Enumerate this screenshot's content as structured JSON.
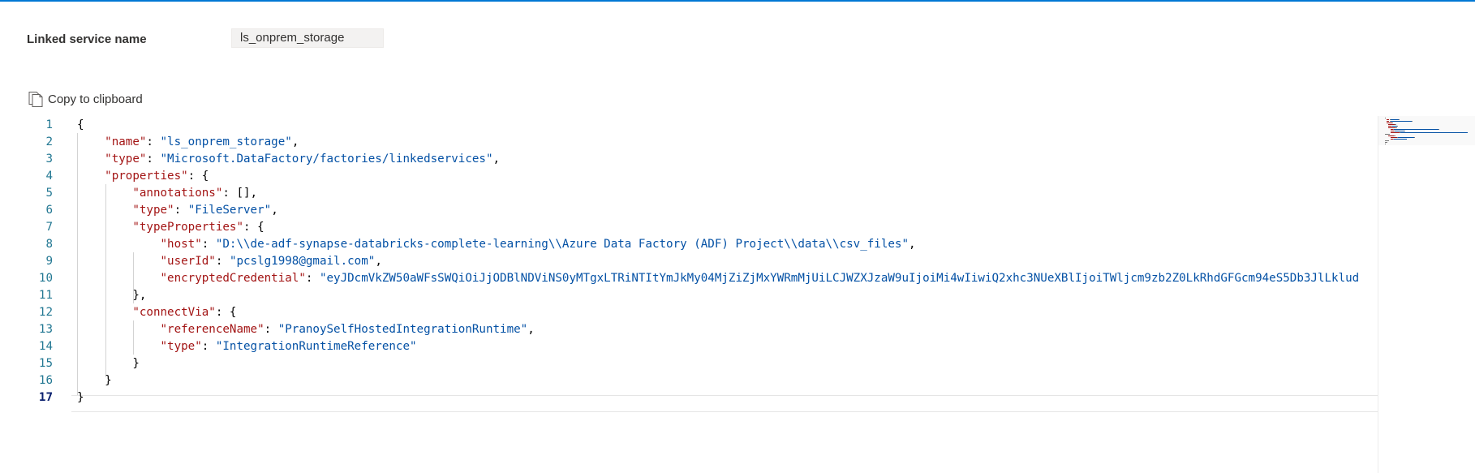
{
  "linked_service": {
    "label": "Linked service name",
    "value": "ls_onprem_storage"
  },
  "copy": {
    "label": "Copy to clipboard",
    "icon": "copy-icon"
  },
  "editor": {
    "active_line": 17,
    "lines": [
      {
        "num": "1",
        "tokens": [
          {
            "t": "punc",
            "v": "{"
          }
        ]
      },
      {
        "num": "2",
        "tokens": [
          {
            "t": "punc",
            "v": "    "
          },
          {
            "t": "key",
            "v": "\"name\""
          },
          {
            "t": "punc",
            "v": ": "
          },
          {
            "t": "str",
            "v": "\"ls_onprem_storage\""
          },
          {
            "t": "punc",
            "v": ","
          }
        ]
      },
      {
        "num": "3",
        "tokens": [
          {
            "t": "punc",
            "v": "    "
          },
          {
            "t": "key",
            "v": "\"type\""
          },
          {
            "t": "punc",
            "v": ": "
          },
          {
            "t": "str",
            "v": "\"Microsoft.DataFactory/factories/linkedservices\""
          },
          {
            "t": "punc",
            "v": ","
          }
        ]
      },
      {
        "num": "4",
        "tokens": [
          {
            "t": "punc",
            "v": "    "
          },
          {
            "t": "key",
            "v": "\"properties\""
          },
          {
            "t": "punc",
            "v": ": {"
          }
        ]
      },
      {
        "num": "5",
        "tokens": [
          {
            "t": "punc",
            "v": "        "
          },
          {
            "t": "key",
            "v": "\"annotations\""
          },
          {
            "t": "punc",
            "v": ": [],"
          }
        ]
      },
      {
        "num": "6",
        "tokens": [
          {
            "t": "punc",
            "v": "        "
          },
          {
            "t": "key",
            "v": "\"type\""
          },
          {
            "t": "punc",
            "v": ": "
          },
          {
            "t": "str",
            "v": "\"FileServer\""
          },
          {
            "t": "punc",
            "v": ","
          }
        ]
      },
      {
        "num": "7",
        "tokens": [
          {
            "t": "punc",
            "v": "        "
          },
          {
            "t": "key",
            "v": "\"typeProperties\""
          },
          {
            "t": "punc",
            "v": ": {"
          }
        ]
      },
      {
        "num": "8",
        "tokens": [
          {
            "t": "punc",
            "v": "            "
          },
          {
            "t": "key",
            "v": "\"host\""
          },
          {
            "t": "punc",
            "v": ": "
          },
          {
            "t": "str",
            "v": "\"D:\\\\de-adf-synapse-databricks-complete-learning\\\\Azure Data Factory (ADF) Project\\\\data\\\\csv_files\""
          },
          {
            "t": "punc",
            "v": ","
          }
        ]
      },
      {
        "num": "9",
        "tokens": [
          {
            "t": "punc",
            "v": "            "
          },
          {
            "t": "key",
            "v": "\"userId\""
          },
          {
            "t": "punc",
            "v": ": "
          },
          {
            "t": "str",
            "v": "\"pcslg1998@gmail.com\""
          },
          {
            "t": "punc",
            "v": ","
          }
        ]
      },
      {
        "num": "10",
        "tokens": [
          {
            "t": "punc",
            "v": "            "
          },
          {
            "t": "key",
            "v": "\"encryptedCredential\""
          },
          {
            "t": "punc",
            "v": ": "
          },
          {
            "t": "str",
            "v": "\"eyJDcmVkZW50aWFsSWQiOiJjODBlNDViNS0yMTgxLTRiNTItYmJkMy04MjZiZjMxYWRmMjUiLCJWZXJzaW9uIjoiMi4wIiwiQ2xhc3NUeXBlIjoiTWljcm9zb2Z0LkRhdGFGcm94eS5Db3JlLklud"
          }
        ]
      },
      {
        "num": "11",
        "tokens": [
          {
            "t": "punc",
            "v": "        },"
          }
        ]
      },
      {
        "num": "12",
        "tokens": [
          {
            "t": "punc",
            "v": "        "
          },
          {
            "t": "key",
            "v": "\"connectVia\""
          },
          {
            "t": "punc",
            "v": ": {"
          }
        ]
      },
      {
        "num": "13",
        "tokens": [
          {
            "t": "punc",
            "v": "            "
          },
          {
            "t": "key",
            "v": "\"referenceName\""
          },
          {
            "t": "punc",
            "v": ": "
          },
          {
            "t": "str",
            "v": "\"PranoySelfHostedIntegrationRuntime\""
          },
          {
            "t": "punc",
            "v": ","
          }
        ]
      },
      {
        "num": "14",
        "tokens": [
          {
            "t": "punc",
            "v": "            "
          },
          {
            "t": "key",
            "v": "\"type\""
          },
          {
            "t": "punc",
            "v": ": "
          },
          {
            "t": "str",
            "v": "\"IntegrationRuntimeReference\""
          }
        ]
      },
      {
        "num": "15",
        "tokens": [
          {
            "t": "punc",
            "v": "        }"
          }
        ]
      },
      {
        "num": "16",
        "tokens": [
          {
            "t": "punc",
            "v": "    }"
          }
        ]
      },
      {
        "num": "17",
        "tokens": [
          {
            "t": "punc",
            "v": "}"
          }
        ]
      }
    ]
  },
  "colors": {
    "accent": "#0078d4",
    "json_key": "#a31515",
    "json_string": "#0451a5",
    "line_number": "#237893"
  }
}
